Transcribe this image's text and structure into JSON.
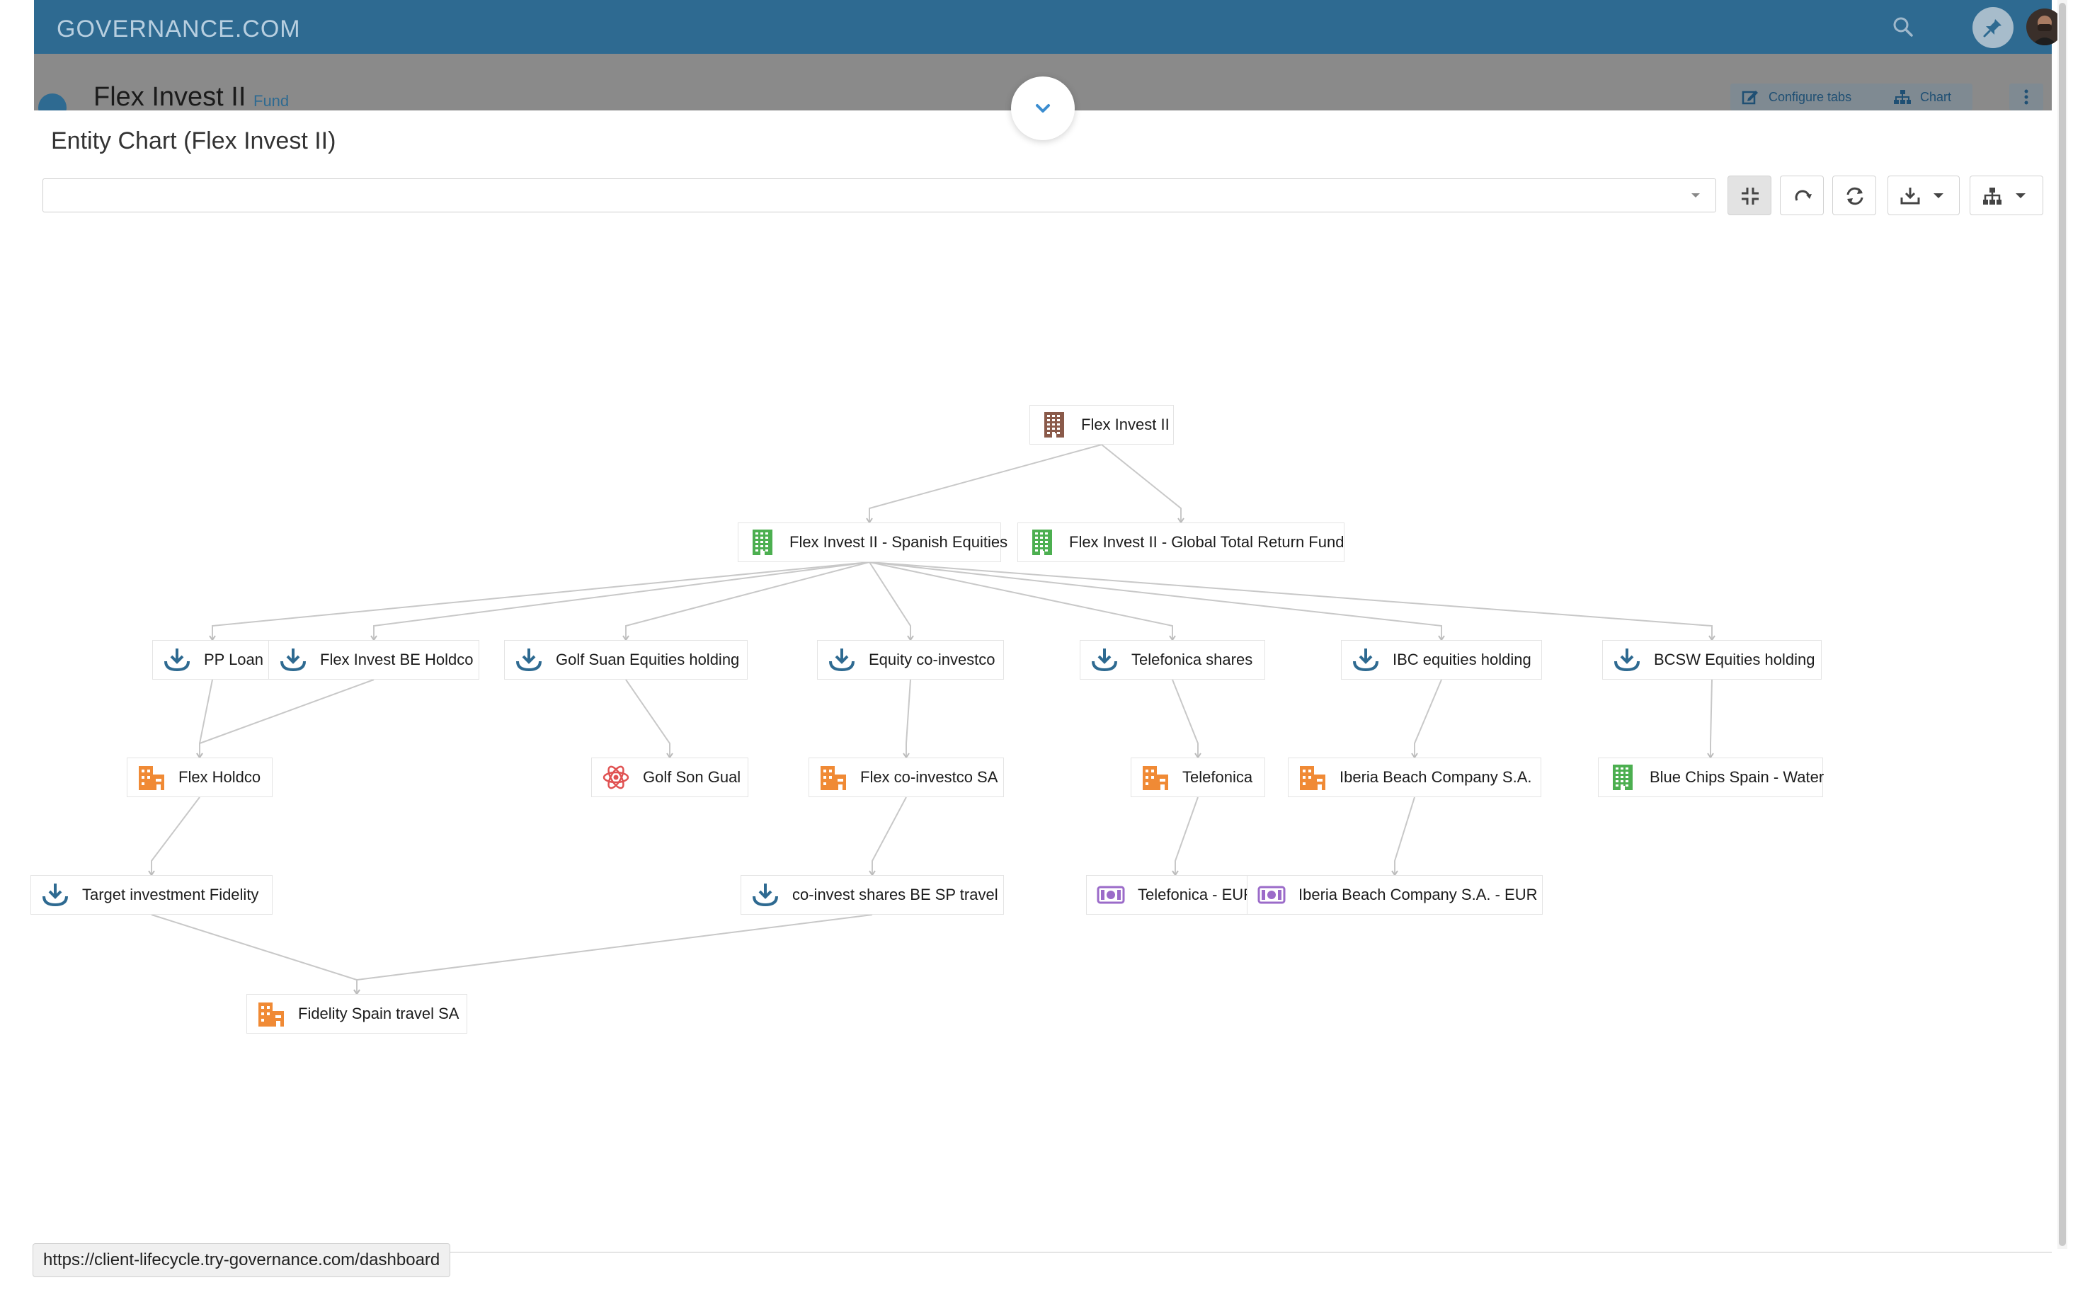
{
  "app": {
    "logo": "GOVERNANCE.COM"
  },
  "header": {
    "entity_name": "Flex Invest II",
    "entity_type": "Fund",
    "configure_tabs_label": "Configure tabs",
    "chart_label": "Chart"
  },
  "page": {
    "title": "Entity Chart (Flex Invest II)"
  },
  "toolbar": {
    "select_value": ""
  },
  "colors": {
    "brand": "#2e6a91",
    "fund_icon": "#8a5a4a",
    "subfund_icon": "#4caf50",
    "holding_icon": "#2e6a91",
    "company_icon": "#f08a35",
    "other_icon": "#e05252",
    "share_class_icon": "#9b6bc9"
  },
  "chart": {
    "nodes": [
      {
        "id": "root",
        "label": "Flex Invest II",
        "icon": "building-icon-brown"
      },
      {
        "id": "spanish",
        "label": "Flex Invest II - Spanish Equities",
        "icon": "building-icon-green"
      },
      {
        "id": "global",
        "label": "Flex Invest II - Global Total Return Fund",
        "icon": "building-icon-green"
      },
      {
        "id": "pploan",
        "label": "PP Loan",
        "icon": "download-icon"
      },
      {
        "id": "beholdco",
        "label": "Flex Invest BE Holdco",
        "icon": "download-icon"
      },
      {
        "id": "golfsuan",
        "label": "Golf Suan Equities holding",
        "icon": "download-icon"
      },
      {
        "id": "equityco",
        "label": "Equity co-investco",
        "icon": "download-icon"
      },
      {
        "id": "telefshares",
        "label": "Telefonica shares",
        "icon": "download-icon"
      },
      {
        "id": "ibc",
        "label": "IBC equities holding",
        "icon": "download-icon"
      },
      {
        "id": "bcsw",
        "label": "BCSW Equities holding",
        "icon": "download-icon"
      },
      {
        "id": "flexholdco",
        "label": "Flex Holdco",
        "icon": "company-icon"
      },
      {
        "id": "golfson",
        "label": "Golf Son Gual",
        "icon": "atom-icon"
      },
      {
        "id": "flexcoinv",
        "label": "Flex co-investco SA",
        "icon": "company-icon"
      },
      {
        "id": "telefonica",
        "label": "Telefonica",
        "icon": "company-icon"
      },
      {
        "id": "iberia",
        "label": "Iberia Beach Company S.A.",
        "icon": "company-icon"
      },
      {
        "id": "bluechips",
        "label": "Blue Chips Spain - Water",
        "icon": "building-icon-green"
      },
      {
        "id": "target",
        "label": "Target investment Fidelity",
        "icon": "download-icon"
      },
      {
        "id": "coinvshares",
        "label": "co-invest shares BE SP travel",
        "icon": "download-icon"
      },
      {
        "id": "telefeur",
        "label": "Telefonica - EUR",
        "icon": "banknote-icon"
      },
      {
        "id": "iberiaeur",
        "label": "Iberia Beach Company S.A. - EUR",
        "icon": "banknote-icon"
      },
      {
        "id": "fidelity",
        "label": "Fidelity Spain travel SA",
        "icon": "company-icon"
      }
    ],
    "edges": [
      [
        "root",
        "spanish"
      ],
      [
        "root",
        "global"
      ],
      [
        "spanish",
        "pploan"
      ],
      [
        "spanish",
        "beholdco"
      ],
      [
        "spanish",
        "golfsuan"
      ],
      [
        "spanish",
        "equityco"
      ],
      [
        "spanish",
        "telefshares"
      ],
      [
        "spanish",
        "ibc"
      ],
      [
        "spanish",
        "bcsw"
      ],
      [
        "pploan",
        "flexholdco"
      ],
      [
        "beholdco",
        "flexholdco"
      ],
      [
        "golfsuan",
        "golfson"
      ],
      [
        "equityco",
        "flexcoinv"
      ],
      [
        "telefshares",
        "telefonica"
      ],
      [
        "ibc",
        "iberia"
      ],
      [
        "bcsw",
        "bluechips"
      ],
      [
        "flexholdco",
        "target"
      ],
      [
        "flexcoinv",
        "coinvshares"
      ],
      [
        "telefonica",
        "telefeur"
      ],
      [
        "iberia",
        "iberiaeur"
      ],
      [
        "target",
        "fidelity"
      ],
      [
        "coinvshares",
        "fidelity"
      ]
    ]
  },
  "status_bar": {
    "url": "https://client-lifecycle.try-governance.com/dashboard"
  }
}
